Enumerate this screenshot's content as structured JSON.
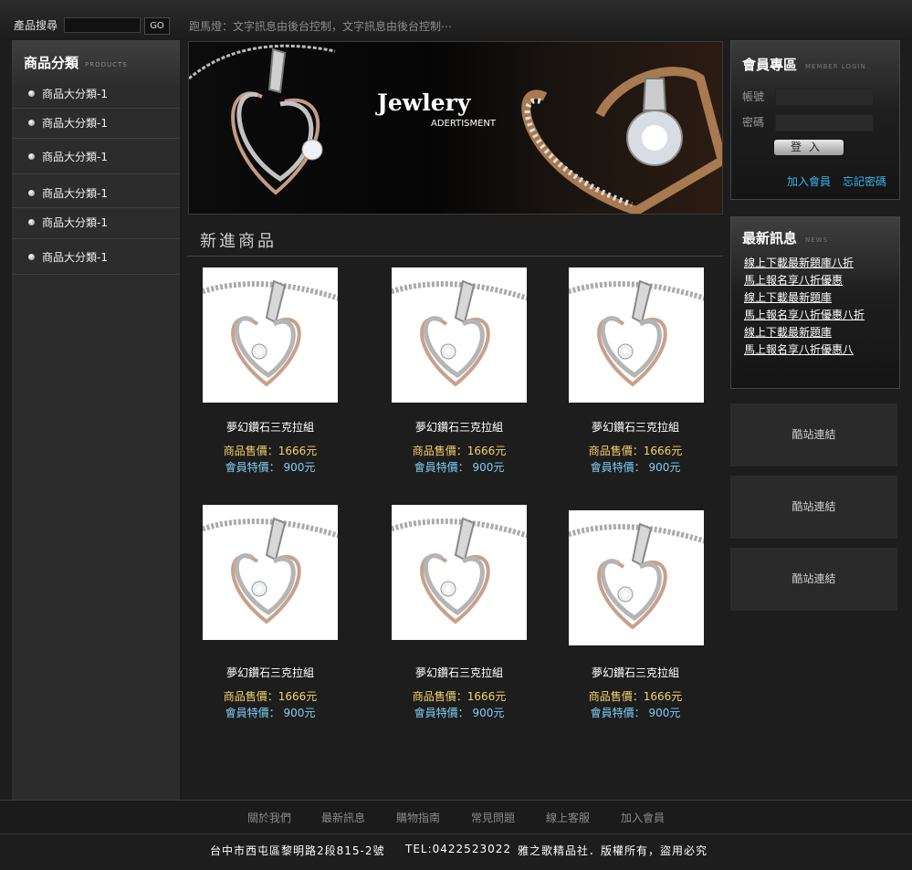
{
  "header": {
    "search_label": "產品搜尋",
    "search_value": "",
    "go_label": "GO",
    "marquee": "跑馬燈：文字訊息由後台控制，文字訊息由後台控制⋯"
  },
  "sidebar": {
    "title": "商品分類",
    "subtitle": "PRODUCTS",
    "items": [
      {
        "label": "商品大分類-1"
      },
      {
        "label": "商品大分類-1"
      },
      {
        "label": "商品大分類-1"
      },
      {
        "label": "商品大分類-1"
      },
      {
        "label": "商品大分類-1"
      },
      {
        "label": "商品大分類-1"
      }
    ]
  },
  "banner": {
    "title": "Jewlery",
    "subtitle": "ADERTISMENT"
  },
  "main": {
    "section_title": "新進商品",
    "products": [
      {
        "name": "夢幻鑽石三克拉組",
        "price": "商品售價：1666元",
        "member": "會員特價：  900元"
      },
      {
        "name": "夢幻鑽石三克拉組",
        "price": "商品售價：1666元",
        "member": "會員特價：  900元"
      },
      {
        "name": "夢幻鑽石三克拉組",
        "price": "商品售價：1666元",
        "member": "會員特價：  900元"
      },
      {
        "name": "夢幻鑽石三克拉組",
        "price": "商品售價：1666元",
        "member": "會員特價：  900元"
      },
      {
        "name": "夢幻鑽石三克拉組",
        "price": "商品售價：1666元",
        "member": "會員特價：  900元"
      },
      {
        "name": "夢幻鑽石三克拉組",
        "price": "商品售價：1666元",
        "member": "會員特價：  900元"
      }
    ]
  },
  "login": {
    "title": "會員專區",
    "subtitle": "MEMBER LOGIN",
    "account_label": "帳號",
    "password_label": "密碼",
    "account_value": "",
    "password_value": "",
    "login_button": "登入",
    "register_link": "加入會員",
    "forgot_link": "忘記密碼"
  },
  "news": {
    "title": "最新訊息",
    "subtitle": "NEWS",
    "items": [
      {
        "text": "線上下載最新題庫八折"
      },
      {
        "text": "馬上報名享八折優惠"
      },
      {
        "text": "線上下載最新題庫"
      },
      {
        "text": "馬上報名享八折優惠八折"
      },
      {
        "text": "線上下載最新題庫"
      },
      {
        "text": "馬上報名享八折優惠八"
      }
    ]
  },
  "links": [
    {
      "label": "酷站連結"
    },
    {
      "label": "酷站連結"
    },
    {
      "label": "酷站連結"
    }
  ],
  "footer": {
    "nav": [
      {
        "label": "關於我們"
      },
      {
        "label": "最新訊息"
      },
      {
        "label": "購物指南"
      },
      {
        "label": "常見問題"
      },
      {
        "label": "線上客服"
      },
      {
        "label": "加入會員"
      }
    ],
    "address": "台中市西屯區黎明路2段815-2號",
    "tel": "TEL:0422523022",
    "copyright": "雅之歌精品社．版權所有，盜用必究"
  },
  "colors": {
    "price": "#f5d36c",
    "member_price": "#7fd0f5",
    "login_link": "#36b3ec"
  }
}
